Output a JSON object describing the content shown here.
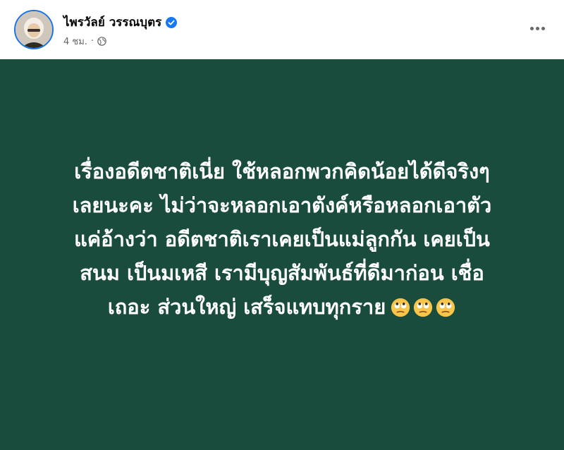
{
  "header": {
    "author_name": "ไพรวัลย์ วรรณบุตร",
    "time": "4 ชม.",
    "separator": "·",
    "verified_icon": "verified-badge-icon",
    "audience_icon": "globe-icon",
    "more_icon": "more-options-icon"
  },
  "post": {
    "background_color": "#1a4c3e",
    "text_color": "#ffffff",
    "lines": [
      "เรื่องอดีตชาติเนี่ย ใช้หลอกพวกคิดน้อยได้ดีจริงๆ",
      "เลยนะคะ ไม่ว่าจะหลอกเอาตังค์หรือหลอกเอาตัว",
      "แค่อ้างว่า อดีตชาติเราเคยเป็นแม่ลูกกัน เคยเป็น",
      "สนม เป็นมเหสี เรามีบุญสัมพันธ์ที่ดีมาก่อน เชื่อ",
      "เถอะ ส่วนใหญ่ เสร็จแทบทุกราย"
    ],
    "emojis": [
      "face-with-rolling-eyes",
      "face-with-rolling-eyes",
      "face-with-rolling-eyes"
    ]
  }
}
